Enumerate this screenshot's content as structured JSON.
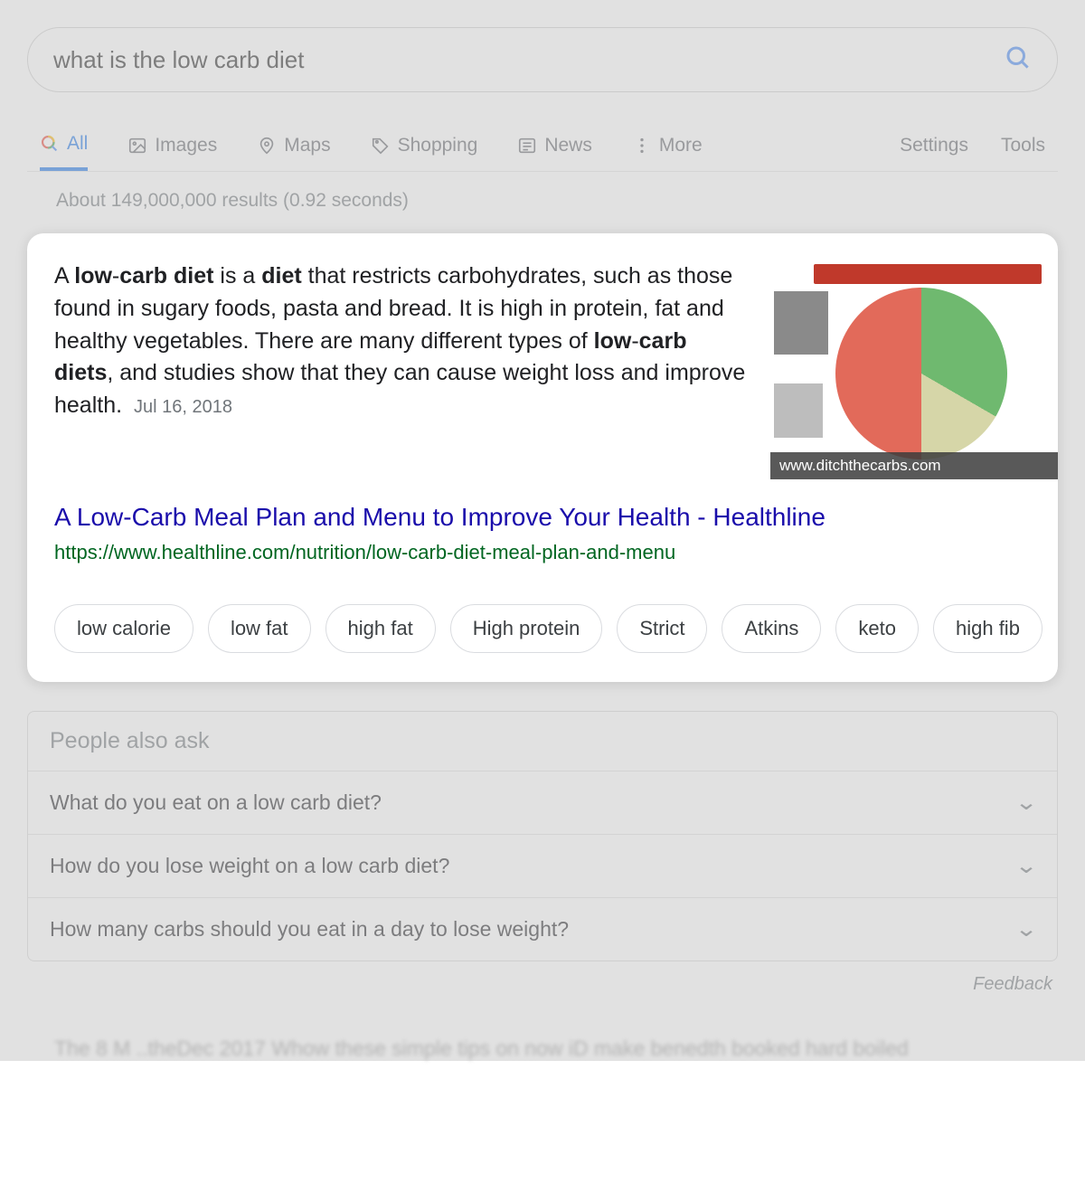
{
  "search": {
    "query": "what is the low carb diet"
  },
  "tabs": {
    "all": "All",
    "images": "Images",
    "maps": "Maps",
    "shopping": "Shopping",
    "news": "News",
    "more": "More"
  },
  "tools": {
    "settings": "Settings",
    "tools": "Tools"
  },
  "stats": "About 149,000,000 results (0.92 seconds)",
  "snippet": {
    "pre": "A ",
    "b1": "low",
    "dash1": "-",
    "b2": "carb diet",
    "mid1": " is a ",
    "b3": "diet",
    "mid2": " that restricts carbohydrates, such as those found in sugary foods, pasta and bread. It is high in protein, fat and healthy vegetables. There are many different types of ",
    "b4": "low",
    "dash2": "-",
    "b5": "carb diets",
    "tail": ", and studies show that they can cause weight loss and improve health.",
    "date": "Jul 16, 2018",
    "image_credit": "www.ditchthecarbs.com",
    "title": "A Low-Carb Meal Plan and Menu to Improve Your Health - Healthline",
    "url": "https://www.healthline.com/nutrition/low-carb-diet-meal-plan-and-menu"
  },
  "chips": [
    "low calorie",
    "low fat",
    "high fat",
    "High protein",
    "Strict",
    "Atkins",
    "keto",
    "high fib"
  ],
  "paa": {
    "header": "People also ask",
    "q1": "What do you eat on a low carb diet?",
    "q2": "How do you lose weight on a low carb diet?",
    "q3": "How many carbs should you eat in a day to lose weight?"
  },
  "feedback": "Feedback",
  "blur": "The 8 M ..theDec 2017  Whow these simple tips on now iD make benedth booked hard boiled"
}
